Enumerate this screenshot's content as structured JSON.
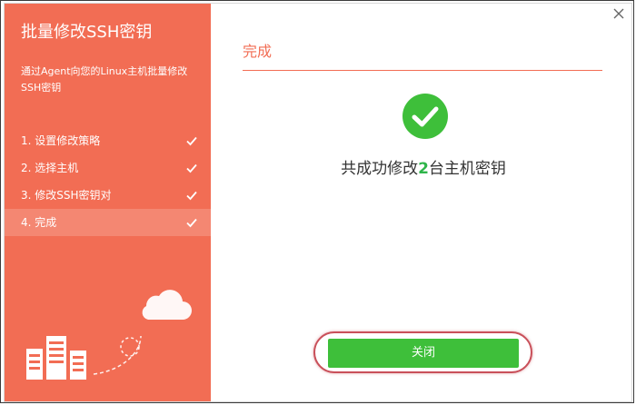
{
  "sidebar": {
    "title": "批量修改SSH密钥",
    "description": "通过Agent向您的Linux主机批量修改SSH密钥",
    "steps": [
      {
        "label": "1. 设置修改策略",
        "done": true
      },
      {
        "label": "2. 选择主机",
        "done": true
      },
      {
        "label": "3. 修改SSH密钥对",
        "done": true
      },
      {
        "label": "4. 完成",
        "done": true,
        "active": true
      }
    ]
  },
  "main": {
    "title": "完成",
    "result": {
      "prefix": "共成功修改",
      "count": "2",
      "suffix": "台主机密钥"
    },
    "close_button": "关闭"
  },
  "colors": {
    "sidebar_bg": "#f26d54",
    "accent": "#f26d54",
    "success": "#3ebf3a",
    "highlight_ring": "#c9505a"
  },
  "icons": {
    "close": "close-icon",
    "check": "check-icon",
    "success": "success-check-circle-icon",
    "cloud": "cloud-icon",
    "server": "server-icon"
  }
}
